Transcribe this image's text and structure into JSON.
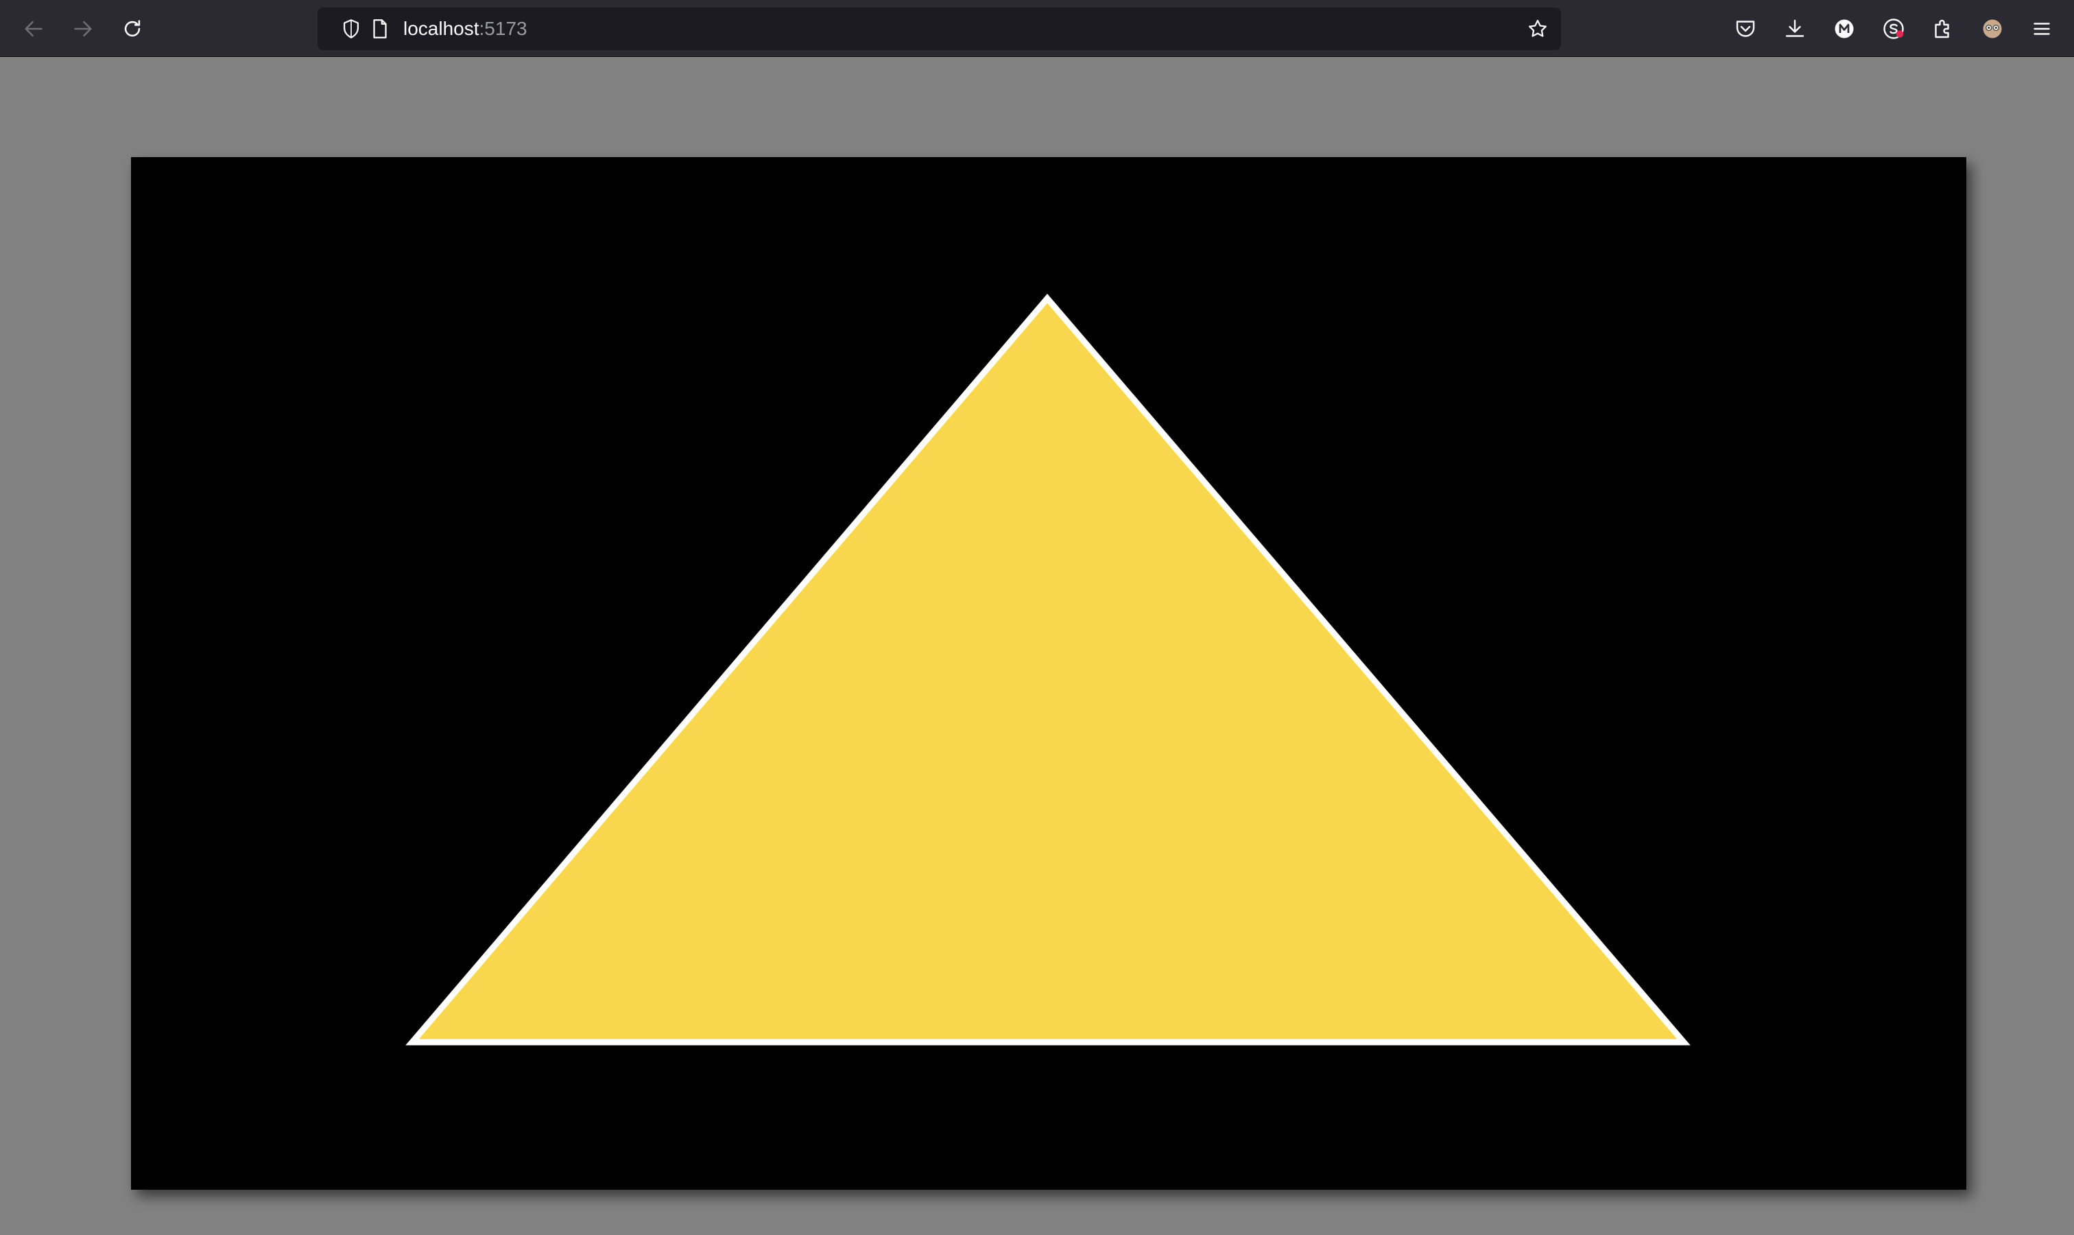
{
  "browser": {
    "url_host": "localhost",
    "url_port": ":5173",
    "toolbar_icons": [
      "back-icon",
      "forward-icon",
      "reload-icon",
      "shield-icon",
      "page-icon",
      "bookmark-star-icon",
      "pocket-icon",
      "download-icon",
      "extension-m-icon",
      "extension-s-icon",
      "extensions-puzzle-icon",
      "account-avatar-icon",
      "menu-icon"
    ]
  },
  "scene": {
    "background_color": "#000000",
    "shape": "triangle",
    "fill_color": "#f8d74e",
    "stroke_color": "#ffffff"
  },
  "colors": {
    "chrome": "#2b2a33",
    "urlbar": "#1c1b22",
    "page_background": "#828282"
  }
}
